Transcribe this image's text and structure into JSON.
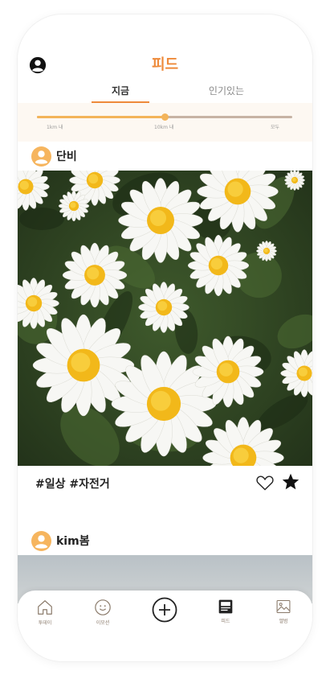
{
  "header": {
    "title": "피드",
    "tabs": [
      {
        "label": "지금",
        "active": true
      },
      {
        "label": "인기있는",
        "active": false
      }
    ]
  },
  "distance_filter": {
    "labels": [
      "1km 내",
      "10km 내",
      "모두"
    ],
    "selected": "10km 내",
    "fill_fraction": 0.5
  },
  "posts": [
    {
      "author": "단비",
      "tags": "#일상 #자전거",
      "liked": false,
      "starred": true
    },
    {
      "author": "kim봄"
    }
  ],
  "bottom_nav": [
    {
      "label": "투데이",
      "icon": "home-icon",
      "active": false
    },
    {
      "label": "이모션",
      "icon": "smile-icon",
      "active": false
    },
    {
      "label": "",
      "icon": "plus-circle-icon",
      "active": false
    },
    {
      "label": "피드",
      "icon": "feed-icon",
      "active": true
    },
    {
      "label": "앨범",
      "icon": "album-icon",
      "active": false
    }
  ],
  "colors": {
    "accent": "#ee8a3a",
    "slider_fill": "#f3b45a",
    "slider_track": "#c7b3a4",
    "avatar": "#f6b55e"
  }
}
